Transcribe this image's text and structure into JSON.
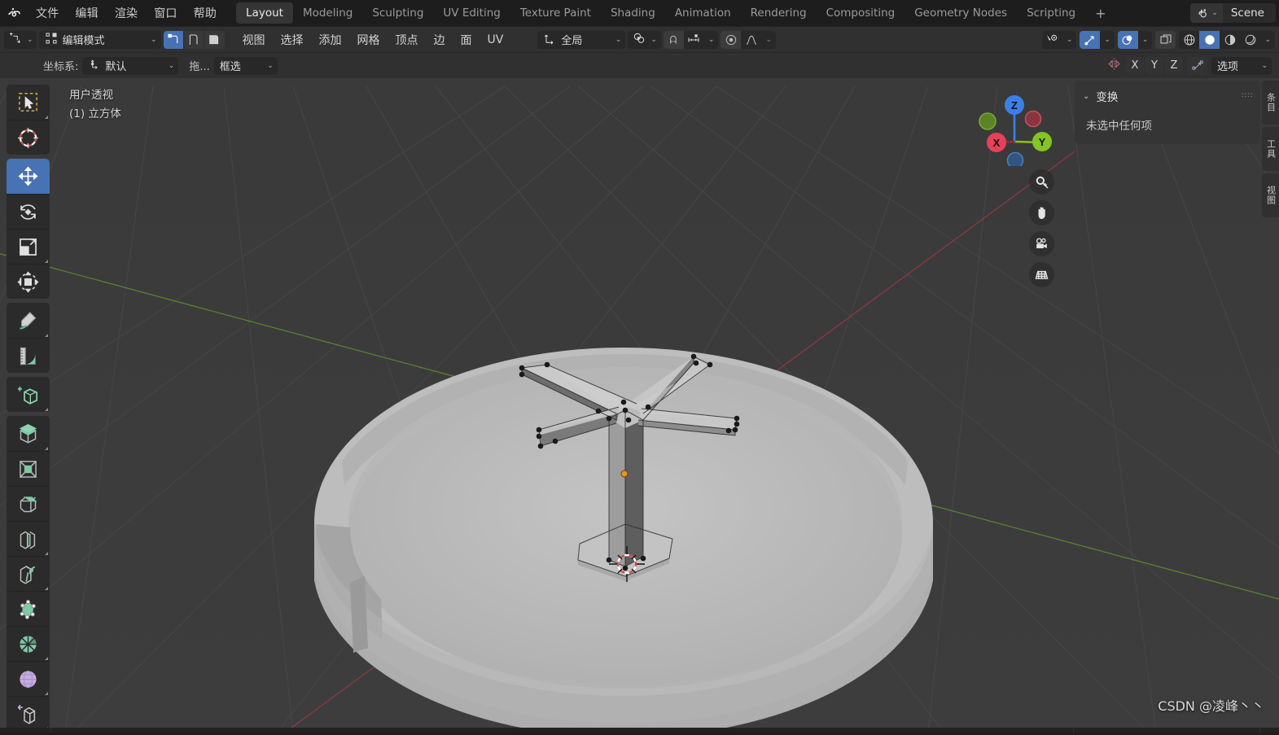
{
  "app": {
    "logo_icon": "blender-logo-icon"
  },
  "topbar": {
    "menus": [
      {
        "label": "文件",
        "name": "menu-file"
      },
      {
        "label": "编辑",
        "name": "menu-edit"
      },
      {
        "label": "渲染",
        "name": "menu-render"
      },
      {
        "label": "窗口",
        "name": "menu-window"
      },
      {
        "label": "帮助",
        "name": "menu-help"
      }
    ],
    "workspaces": [
      {
        "label": "Layout",
        "active": true
      },
      {
        "label": "Modeling",
        "active": false
      },
      {
        "label": "Sculpting",
        "active": false
      },
      {
        "label": "UV Editing",
        "active": false
      },
      {
        "label": "Texture Paint",
        "active": false
      },
      {
        "label": "Shading",
        "active": false
      },
      {
        "label": "Animation",
        "active": false
      },
      {
        "label": "Rendering",
        "active": false
      },
      {
        "label": "Compositing",
        "active": false
      },
      {
        "label": "Geometry Nodes",
        "active": false
      },
      {
        "label": "Scripting",
        "active": false
      }
    ],
    "add_workspace_label": "+",
    "scene": {
      "icon": "scene-icon",
      "name": "Scene",
      "caret": "⌄"
    }
  },
  "toolheader": {
    "editor_type_icon": "editor-type-3dview-icon",
    "mode": {
      "icon": "edit-mode-icon",
      "label": "编辑模式",
      "caret": "⌄"
    },
    "select_modes": [
      {
        "name": "vertex-select-mode",
        "icon": "vertex-icon",
        "active": true
      },
      {
        "name": "edge-select-mode",
        "icon": "edge-icon",
        "active": false
      },
      {
        "name": "face-select-mode",
        "icon": "face-icon",
        "active": false
      }
    ],
    "menus": [
      {
        "label": "视图",
        "name": "menu-view"
      },
      {
        "label": "选择",
        "name": "menu-select"
      },
      {
        "label": "添加",
        "name": "menu-add"
      },
      {
        "label": "网格",
        "name": "menu-mesh"
      },
      {
        "label": "顶点",
        "name": "menu-vertex"
      },
      {
        "label": "边",
        "name": "menu-edge"
      },
      {
        "label": "面",
        "name": "menu-face"
      },
      {
        "label": "UV",
        "name": "menu-uv"
      }
    ],
    "orientation": {
      "icon": "orientation-icon",
      "label": "全局",
      "caret": "⌄"
    },
    "pivot": {
      "icon": "pivot-icon",
      "caret": "⌄"
    },
    "snap": {
      "magnet_icon": "magnet-icon",
      "snap_to_icon": "snap-increment-icon",
      "caret": "⌄",
      "enabled": false
    },
    "proportional": {
      "icon": "proportional-edit-icon",
      "falloff_icon": "falloff-smooth-icon",
      "caret": "⌄",
      "enabled": false
    },
    "right": {
      "visibility": {
        "icon": "object-visibility-icon",
        "caret": "⌄"
      },
      "gizmo": {
        "icon": "gizmo-icon",
        "caret": "⌄",
        "enabled": true
      },
      "overlays": {
        "icon": "overlays-icon",
        "caret": "⌄",
        "enabled": true
      },
      "xray": {
        "icon": "xray-toggle-icon",
        "enabled": false
      },
      "shading": [
        {
          "name": "shading-wireframe",
          "icon": "wireframe-icon",
          "active": false
        },
        {
          "name": "shading-solid",
          "icon": "solid-icon",
          "active": true
        },
        {
          "name": "shading-material",
          "icon": "material-preview-icon",
          "active": false
        },
        {
          "name": "shading-rendered",
          "icon": "rendered-icon",
          "active": false
        }
      ],
      "shading_caret": "⌄"
    }
  },
  "toolsettings": {
    "orientation_label": "坐标系:",
    "transform_preset": {
      "icon": "transform-orientation-icon",
      "label": "默认",
      "caret": "⌄"
    },
    "drag_label": "拖...",
    "drag_mode": {
      "label": "框选",
      "caret": "⌄"
    },
    "mirror": {
      "icon": "mirror-icon",
      "axes": [
        {
          "label": "X",
          "active": false
        },
        {
          "label": "Y",
          "active": false
        },
        {
          "label": "Z",
          "active": false
        }
      ]
    },
    "uv_mirror_icon": "uv-mirror-icon",
    "options": {
      "label": "选项",
      "caret": "⌄"
    }
  },
  "viewport": {
    "view_name": "用户透视",
    "object_info": "(1) 立方体",
    "background_color": "#3b3b3b",
    "grid_line_color": "#4a4a4a",
    "axis_x_color": "#a33b4a",
    "axis_y_color": "#5a8c2d",
    "gizmo": {
      "axes": [
        {
          "label": "Z",
          "color": "#3b80e8",
          "name": "gizmo-axis-z"
        },
        {
          "label": "Y",
          "color": "#84c423",
          "name": "gizmo-axis-y"
        },
        {
          "label": "X",
          "color": "#e5415a",
          "name": "gizmo-axis-x"
        }
      ],
      "neg_axes": [
        {
          "color": "#5b8225",
          "name": "gizmo-axis-neg-y"
        },
        {
          "color": "#8a3440",
          "name": "gizmo-axis-neg-x"
        },
        {
          "color": "#2f5580",
          "name": "gizmo-axis-neg-z"
        }
      ]
    },
    "nav_buttons": [
      {
        "name": "zoom-view-button",
        "icon": "zoom-icon"
      },
      {
        "name": "pan-view-button",
        "icon": "hand-icon"
      },
      {
        "name": "camera-view-button",
        "icon": "camera-icon"
      },
      {
        "name": "toggle-ortho-button",
        "icon": "grid-perspective-icon"
      }
    ],
    "cursor_3d_icon": "3d-cursor-icon",
    "origin_point_color": "#e8932a",
    "watermark": "CSDN @凌峰丶丶"
  },
  "lefttoolbar": {
    "groups": [
      {
        "tools": [
          {
            "name": "tool-tweak-select-box",
            "icon": "select-box-icon",
            "active": false,
            "has_submenu": true
          },
          {
            "name": "tool-cursor",
            "icon": "cursor-icon",
            "active": false,
            "has_submenu": false
          }
        ]
      },
      {
        "tools": [
          {
            "name": "tool-move",
            "icon": "move-icon",
            "active": true,
            "has_submenu": false
          },
          {
            "name": "tool-rotate",
            "icon": "rotate-icon",
            "active": false,
            "has_submenu": false
          },
          {
            "name": "tool-scale",
            "icon": "scale-icon",
            "active": false,
            "has_submenu": true
          },
          {
            "name": "tool-transform",
            "icon": "transform-icon",
            "active": false,
            "has_submenu": false
          }
        ]
      },
      {
        "tools": [
          {
            "name": "tool-annotate",
            "icon": "annotate-icon",
            "active": false,
            "has_submenu": true
          },
          {
            "name": "tool-measure",
            "icon": "measure-icon",
            "active": false,
            "has_submenu": false
          }
        ]
      },
      {
        "tools": [
          {
            "name": "tool-add-cube",
            "icon": "add-cube-icon",
            "active": false,
            "has_submenu": true
          }
        ]
      },
      {
        "tools": [
          {
            "name": "tool-extrude-region",
            "icon": "extrude-region-icon",
            "active": false,
            "has_submenu": true
          },
          {
            "name": "tool-inset-faces",
            "icon": "inset-faces-icon",
            "active": false,
            "has_submenu": false
          },
          {
            "name": "tool-bevel",
            "icon": "bevel-icon",
            "active": false,
            "has_submenu": false
          },
          {
            "name": "tool-loop-cut",
            "icon": "loop-cut-icon",
            "active": false,
            "has_submenu": true
          },
          {
            "name": "tool-knife",
            "icon": "knife-icon",
            "active": false,
            "has_submenu": true
          },
          {
            "name": "tool-poly-build",
            "icon": "poly-build-icon",
            "active": false,
            "has_submenu": false
          },
          {
            "name": "tool-spin",
            "icon": "spin-icon",
            "active": false,
            "has_submenu": true
          },
          {
            "name": "tool-smooth",
            "icon": "smooth-icon",
            "active": false,
            "has_submenu": true
          },
          {
            "name": "tool-edge-slide",
            "icon": "edge-slide-icon",
            "active": false,
            "has_submenu": true
          }
        ]
      }
    ]
  },
  "npanel": {
    "section_title": "变换",
    "triangle": "⌄",
    "grip_icon": "drag-grip-icon",
    "empty_message": "未选中任何项",
    "tabs": [
      {
        "label": "条目",
        "name": "npanel-tab-item"
      },
      {
        "label": "工具",
        "name": "npanel-tab-tool"
      },
      {
        "label": "视图",
        "name": "npanel-tab-view"
      }
    ]
  }
}
